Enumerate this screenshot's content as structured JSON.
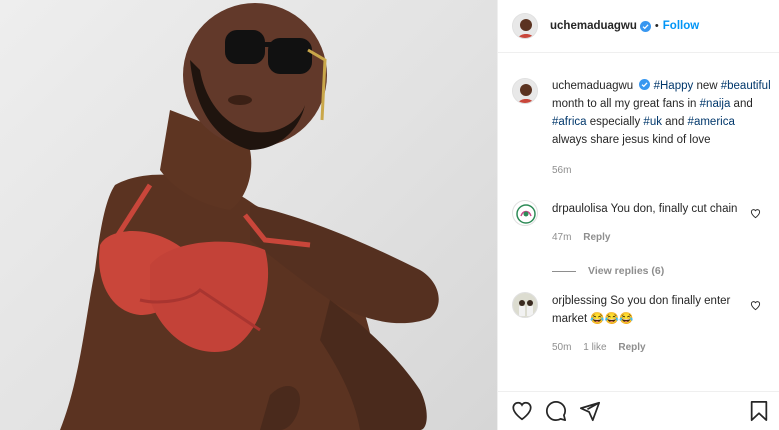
{
  "post": {
    "username": "uchemaduagwu",
    "follow_label": "Follow",
    "dot": "•"
  },
  "caption": {
    "username": "uchemaduagwu",
    "segments": [
      {
        "text": "#Happy",
        "tag": true
      },
      {
        "text": " new ",
        "tag": false
      },
      {
        "text": "#beautiful",
        "tag": true
      },
      {
        "text": " month to all my great fans in ",
        "tag": false
      },
      {
        "text": "#naija",
        "tag": true
      },
      {
        "text": " and ",
        "tag": false
      },
      {
        "text": "#africa",
        "tag": true
      },
      {
        "text": " especially ",
        "tag": false
      },
      {
        "text": "#uk",
        "tag": true
      },
      {
        "text": " and ",
        "tag": false
      },
      {
        "text": "#america",
        "tag": true
      },
      {
        "text": " always share jesus kind of love",
        "tag": false
      }
    ],
    "time": "56m"
  },
  "comments": [
    {
      "username": "drpaulolisa",
      "text": "You don, finally cut chain",
      "time": "47m",
      "likes": "",
      "reply_label": "Reply",
      "view_replies": "View replies (6)"
    },
    {
      "username": "orjblessing",
      "text": "So you don finally enter market 😂😂😂",
      "time": "50m",
      "likes": "1 like",
      "reply_label": "Reply"
    }
  ],
  "icons": {
    "verified": "verified-badge-icon",
    "heart": "heart-icon",
    "comment": "comment-icon",
    "share": "share-icon",
    "save": "bookmark-icon"
  },
  "colors": {
    "accent": "#0095f6",
    "hashtag": "#00376b",
    "muted": "#8e8e8e",
    "bra": "#c9463a"
  }
}
